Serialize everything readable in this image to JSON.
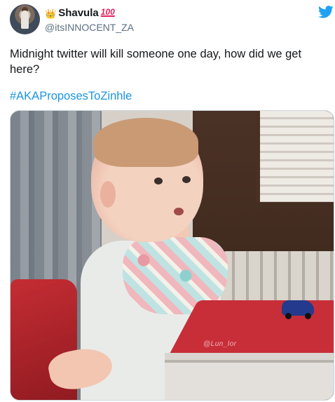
{
  "tweet": {
    "display_name": "Shavula",
    "name_emoji_before": "👑",
    "name_emoji_after": "💯",
    "handle": "@itsINNOCENT_ZA",
    "text": "Midnight twitter will kill someone one day, how did we get here?",
    "hashtag": "#AKAProposesToZinhle",
    "media_watermark": "@Lun_lor",
    "brand_icon": "twitter-bird-icon",
    "colors": {
      "brand": "#1da1f2",
      "link": "#1b95e0",
      "text": "#14171a",
      "secondary": "#5b7083"
    }
  }
}
